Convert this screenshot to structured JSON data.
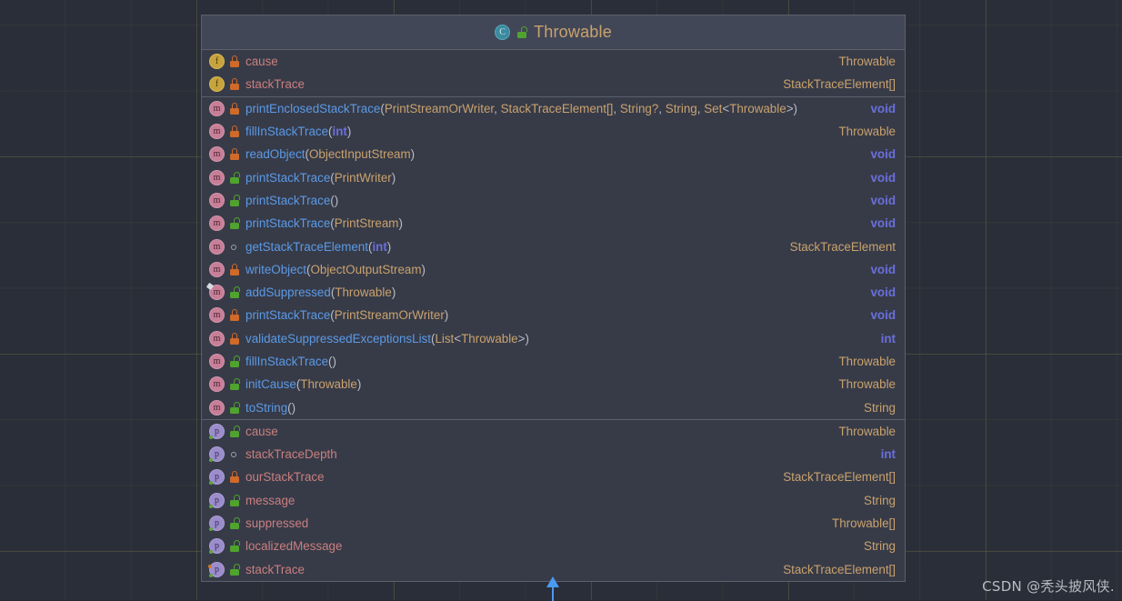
{
  "watermark": "CSDN @秃头披风侠.",
  "class_box": {
    "title": "Throwable",
    "title_icon": "class-icon",
    "visibility_icon": "unlock-green-icon",
    "sections": [
      {
        "name": "fields",
        "rows": [
          {
            "icon": "field-icon",
            "visibility": "lock-orange",
            "name": "cause",
            "params": "",
            "return": "Throwable",
            "return_kind": "class"
          },
          {
            "icon": "field-icon",
            "visibility": "lock-orange",
            "name": "stackTrace",
            "params": "",
            "return": "StackTraceElement[]",
            "return_kind": "class"
          }
        ]
      },
      {
        "name": "methods",
        "rows": [
          {
            "icon": "method-icon",
            "visibility": "lock-orange",
            "name": "printEnclosedStackTrace",
            "params": "(PrintStreamOrWriter, StackTraceElement[], String?, String, Set<Throwable>)",
            "return": "void",
            "return_kind": "primitive"
          },
          {
            "icon": "method-icon",
            "visibility": "lock-orange",
            "name": "fillInStackTrace",
            "params": "(int)",
            "return": "Throwable",
            "return_kind": "class"
          },
          {
            "icon": "method-icon",
            "visibility": "lock-orange",
            "name": "readObject",
            "params": "(ObjectInputStream)",
            "return": "void",
            "return_kind": "primitive"
          },
          {
            "icon": "method-icon",
            "visibility": "unlock-green",
            "name": "printStackTrace",
            "params": "(PrintWriter)",
            "return": "void",
            "return_kind": "primitive"
          },
          {
            "icon": "method-icon",
            "visibility": "unlock-green",
            "name": "printStackTrace",
            "params": "()",
            "return": "void",
            "return_kind": "primitive"
          },
          {
            "icon": "method-icon",
            "visibility": "unlock-green",
            "name": "printStackTrace",
            "params": "(PrintStream)",
            "return": "void",
            "return_kind": "primitive"
          },
          {
            "icon": "method-icon",
            "visibility": "package",
            "name": "getStackTraceElement",
            "params": "(int)",
            "return": "StackTraceElement",
            "return_kind": "class"
          },
          {
            "icon": "method-icon",
            "visibility": "lock-orange",
            "name": "writeObject",
            "params": "(ObjectOutputStream)",
            "return": "void",
            "return_kind": "primitive"
          },
          {
            "icon": "method-icon-override",
            "visibility": "unlock-green",
            "name": "addSuppressed",
            "params": "(Throwable)",
            "return": "void",
            "return_kind": "primitive"
          },
          {
            "icon": "method-icon",
            "visibility": "lock-orange",
            "name": "printStackTrace",
            "params": "(PrintStreamOrWriter)",
            "return": "void",
            "return_kind": "primitive"
          },
          {
            "icon": "method-icon",
            "visibility": "lock-orange",
            "name": "validateSuppressedExceptionsList",
            "params": "(List<Throwable>)",
            "return": "int",
            "return_kind": "primitive"
          },
          {
            "icon": "method-icon",
            "visibility": "unlock-green",
            "name": "fillInStackTrace",
            "params": "()",
            "return": "Throwable",
            "return_kind": "class"
          },
          {
            "icon": "method-icon",
            "visibility": "unlock-green",
            "name": "initCause",
            "params": "(Throwable)",
            "return": "Throwable",
            "return_kind": "class"
          },
          {
            "icon": "method-icon",
            "visibility": "unlock-green",
            "name": "toString",
            "params": "()",
            "return": "String",
            "return_kind": "class"
          }
        ]
      },
      {
        "name": "properties",
        "rows": [
          {
            "icon": "property-icon",
            "visibility": "unlock-green",
            "name": "cause",
            "params": "",
            "return": "Throwable",
            "return_kind": "class"
          },
          {
            "icon": "property-icon",
            "visibility": "package",
            "name": "stackTraceDepth",
            "params": "",
            "return": "int",
            "return_kind": "primitive"
          },
          {
            "icon": "property-icon",
            "visibility": "lock-orange",
            "name": "ourStackTrace",
            "params": "",
            "return": "StackTraceElement[]",
            "return_kind": "class"
          },
          {
            "icon": "property-icon",
            "visibility": "unlock-green",
            "name": "message",
            "params": "",
            "return": "String",
            "return_kind": "class"
          },
          {
            "icon": "property-icon",
            "visibility": "unlock-green",
            "name": "suppressed",
            "params": "",
            "return": "Throwable[]",
            "return_kind": "class"
          },
          {
            "icon": "property-icon",
            "visibility": "unlock-green",
            "name": "localizedMessage",
            "params": "",
            "return": "String",
            "return_kind": "class"
          },
          {
            "icon": "property-icon-warn",
            "visibility": "unlock-green",
            "name": "stackTrace",
            "params": "",
            "return": "StackTraceElement[]",
            "return_kind": "class"
          }
        ]
      }
    ]
  }
}
